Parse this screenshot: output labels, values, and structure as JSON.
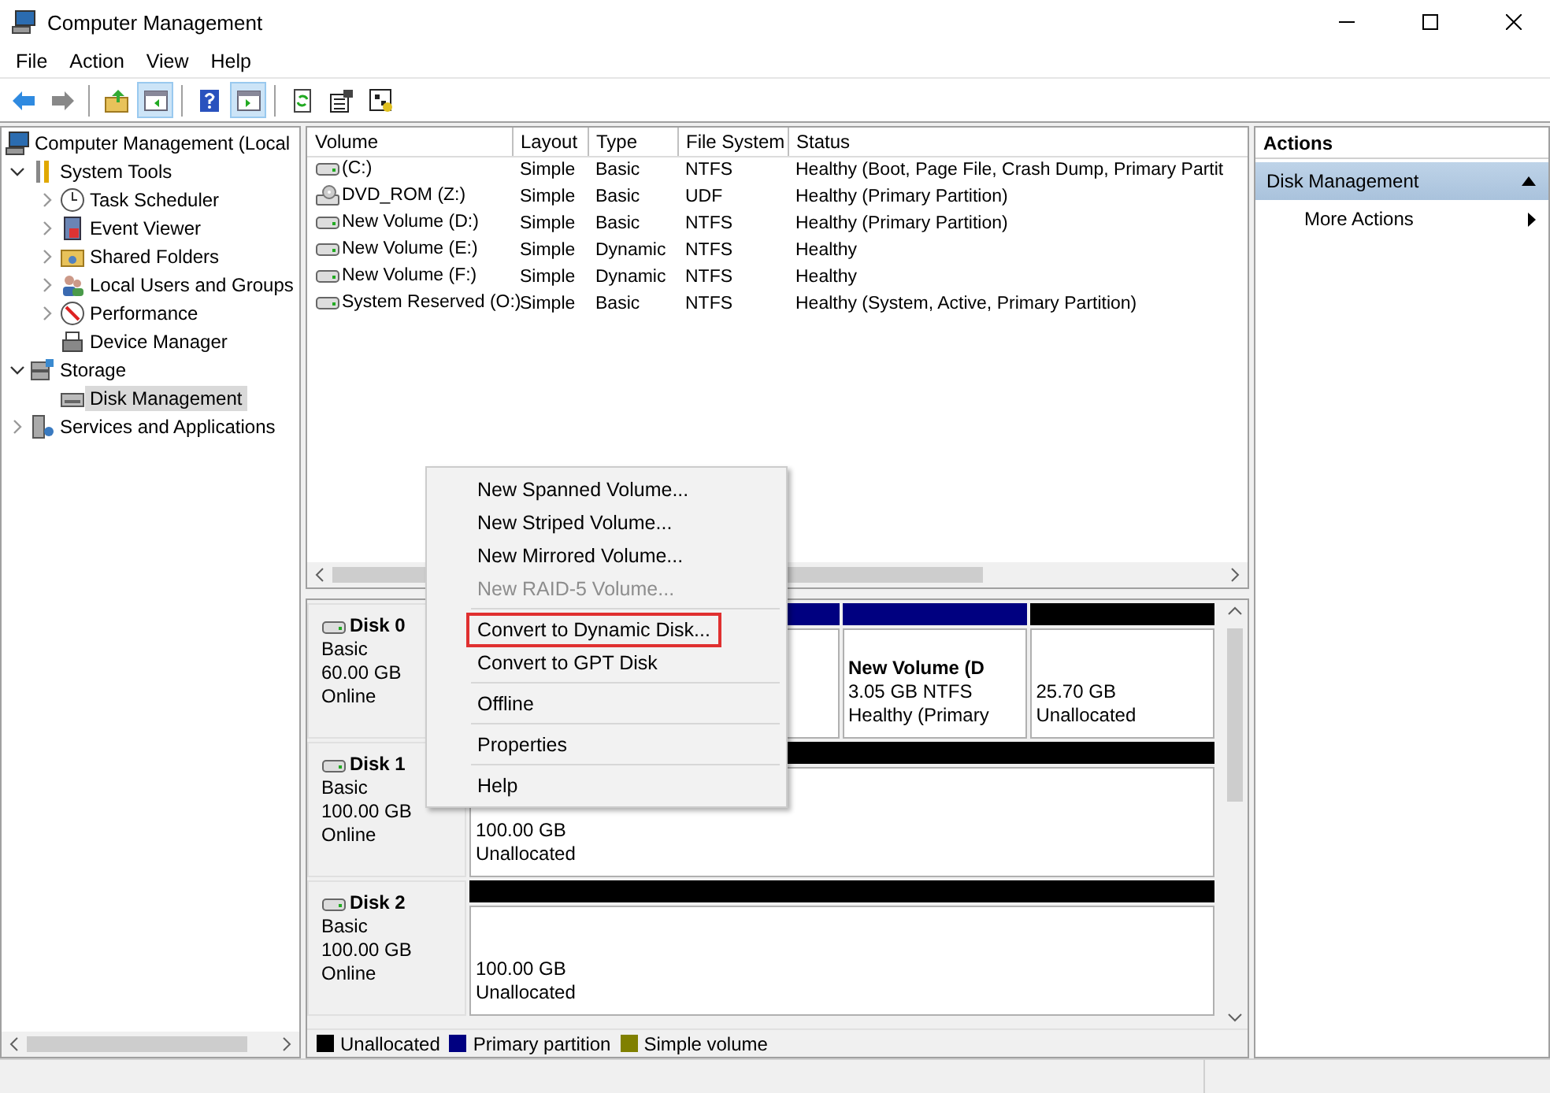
{
  "window": {
    "title": "Computer Management"
  },
  "menu_bar": [
    "File",
    "Action",
    "View",
    "Help"
  ],
  "toolbar_groups": [
    [
      {
        "pressed": false
      },
      {
        "pressed": false
      }
    ],
    [
      {
        "pressed": false
      },
      {
        "pressed": true
      }
    ],
    [
      {
        "pressed": false
      },
      {
        "pressed": true
      }
    ],
    [
      {
        "pressed": false
      },
      {
        "pressed": false
      },
      {
        "pressed": false
      }
    ]
  ],
  "tree": [
    {
      "label": "Computer Management (Local",
      "selected": false,
      "children": [
        {
          "label": "System Tools",
          "expanded": true,
          "selected": false,
          "children": [
            {
              "label": "Task Scheduler",
              "expanded": false,
              "selected": false
            },
            {
              "label": "Event Viewer",
              "expanded": false,
              "selected": false
            },
            {
              "label": "Shared Folders",
              "expanded": false,
              "selected": false
            },
            {
              "label": "Local Users and Groups",
              "expanded": false,
              "selected": false
            },
            {
              "label": "Performance",
              "expanded": false,
              "selected": false
            },
            {
              "label": "Device Manager",
              "selected": false
            }
          ]
        },
        {
          "label": "Storage",
          "expanded": true,
          "selected": false,
          "children": [
            {
              "label": "Disk Management",
              "selected": true
            }
          ]
        },
        {
          "label": "Services and Applications",
          "expanded": false,
          "selected": false
        }
      ]
    }
  ],
  "volume_table": {
    "columns": [
      "Volume",
      "Layout",
      "Type",
      "File System",
      "Status"
    ],
    "rows": [
      {
        "kind": "disk",
        "cells": [
          " (C:)",
          "Simple",
          "Basic",
          "NTFS",
          "Healthy (Boot, Page File, Crash Dump, Primary Partit"
        ]
      },
      {
        "kind": "dvd",
        "cells": [
          "DVD_ROM (Z:)",
          "Simple",
          "Basic",
          "UDF",
          "Healthy (Primary Partition)"
        ]
      },
      {
        "kind": "disk",
        "cells": [
          "New Volume (D:)",
          "Simple",
          "Basic",
          "NTFS",
          "Healthy (Primary Partition)"
        ]
      },
      {
        "kind": "disk",
        "cells": [
          "New Volume (E:)",
          "Simple",
          "Dynamic",
          "NTFS",
          "Healthy"
        ]
      },
      {
        "kind": "disk",
        "cells": [
          "New Volume (F:)",
          "Simple",
          "Dynamic",
          "NTFS",
          "Healthy"
        ]
      },
      {
        "kind": "disk",
        "cells": [
          "System Reserved (O:)",
          "Simple",
          "Basic",
          "NTFS",
          "Healthy (System, Active, Primary Partition)"
        ]
      }
    ]
  },
  "disks": [
    {
      "name": "Disk 0",
      "type": "Basic",
      "size": "60.00 GB",
      "status": "Online",
      "partitions": [
        {
          "color": "#000080"
        },
        {
          "color": "#000080",
          "title": "New Volume  (D",
          "lines": [
            "3.05 GB NTFS",
            "Healthy (Primary"
          ]
        },
        {
          "color": "#000000",
          "lines": [
            "25.70 GB",
            "Unallocated"
          ]
        }
      ]
    },
    {
      "name": "Disk 1",
      "type": "Basic",
      "size": "100.00 GB",
      "status": "Online",
      "partitions": [
        {
          "color": "#000000",
          "lines": [
            "100.00 GB",
            "Unallocated"
          ]
        }
      ]
    },
    {
      "name": "Disk 2",
      "type": "Basic",
      "size": "100.00 GB",
      "status": "Online",
      "partitions": [
        {
          "color": "#000000",
          "lines": [
            "100.00 GB",
            "Unallocated"
          ]
        }
      ]
    }
  ],
  "legend": [
    {
      "label": "Unallocated",
      "color": "#000000"
    },
    {
      "label": "Primary partition",
      "color": "#000080"
    },
    {
      "label": "Simple volume",
      "color": "#808000"
    }
  ],
  "context_menu": [
    {
      "kind": "item",
      "label": "New Spanned Volume...",
      "disabled": false,
      "highlighted": false
    },
    {
      "kind": "item",
      "label": "New Striped Volume...",
      "disabled": false,
      "highlighted": false
    },
    {
      "kind": "item",
      "label": "New Mirrored Volume...",
      "disabled": false,
      "highlighted": false
    },
    {
      "kind": "item",
      "label": "New RAID-5 Volume...",
      "disabled": true,
      "highlighted": false
    },
    {
      "kind": "separator"
    },
    {
      "kind": "item",
      "label": "Convert to Dynamic Disk...",
      "disabled": false,
      "highlighted": true
    },
    {
      "kind": "item",
      "label": "Convert to GPT Disk",
      "disabled": false,
      "highlighted": false
    },
    {
      "kind": "separator"
    },
    {
      "kind": "item",
      "label": "Offline",
      "disabled": false,
      "highlighted": false
    },
    {
      "kind": "separator"
    },
    {
      "kind": "item",
      "label": "Properties",
      "disabled": false,
      "highlighted": false
    },
    {
      "kind": "separator"
    },
    {
      "kind": "item",
      "label": "Help",
      "disabled": false,
      "highlighted": false
    }
  ],
  "actions": {
    "title": "Actions",
    "section": "Disk Management",
    "items": [
      "More Actions"
    ]
  }
}
